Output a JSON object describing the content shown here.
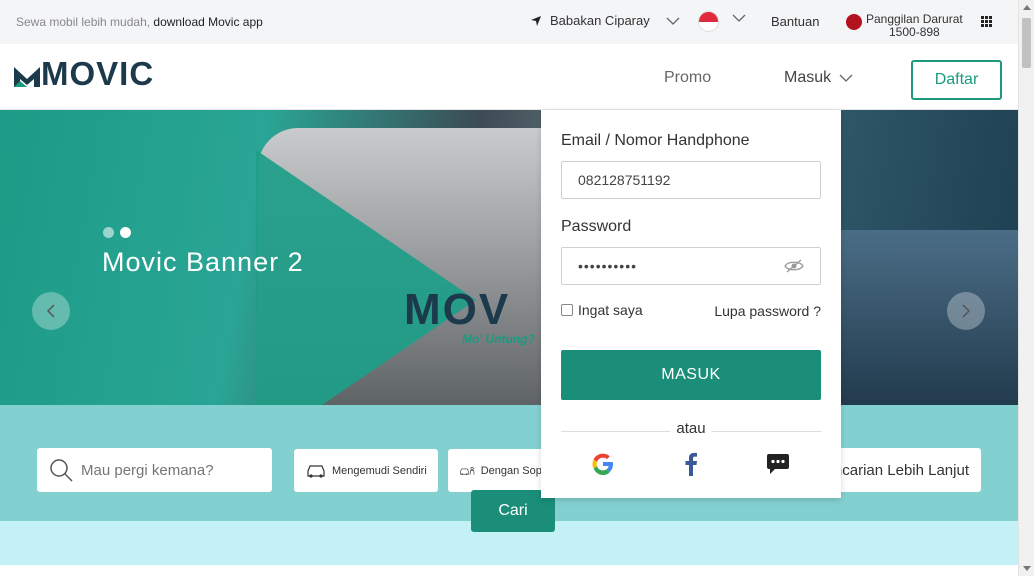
{
  "topbar": {
    "promo_text": "Sewa mobil lebih mudah,",
    "promo_link": "download Movic app",
    "location": "Babakan Ciparay",
    "help": "Bantuan",
    "emergency_label": "Panggilan Darurat",
    "emergency_number": "1500-898"
  },
  "header": {
    "logo": "MOVIC",
    "nav_promo": "Promo",
    "nav_login": "Masuk",
    "register_button": "Daftar"
  },
  "hero": {
    "banner_title": "Movic Banner 2",
    "brand_text": "MOV",
    "tagline": "Mo' Untung?",
    "slide_count": 2,
    "active_slide": 2
  },
  "search": {
    "placeholder": "Mau pergi kemana?",
    "option_self_drive": "Mengemudi Sendiri",
    "option_with_driver": "Dengan Sopir",
    "more_search": "Pencarian Lebih Lanjut",
    "search_button": "Cari"
  },
  "login": {
    "email_label": "Email / Nomor Handphone",
    "email_value": "082128751192",
    "password_label": "Password",
    "password_value": "••••••••••",
    "remember_label": "Ingat saya",
    "forgot_label": "Lupa password ?",
    "submit_label": "MASUK",
    "or_label": "atau",
    "social": [
      "google-icon",
      "facebook-icon",
      "chat-icon"
    ]
  },
  "colors": {
    "brand_green": "#1a8e78",
    "brand_dark": "#1c3a4c",
    "emergency_red": "#b3131f"
  }
}
